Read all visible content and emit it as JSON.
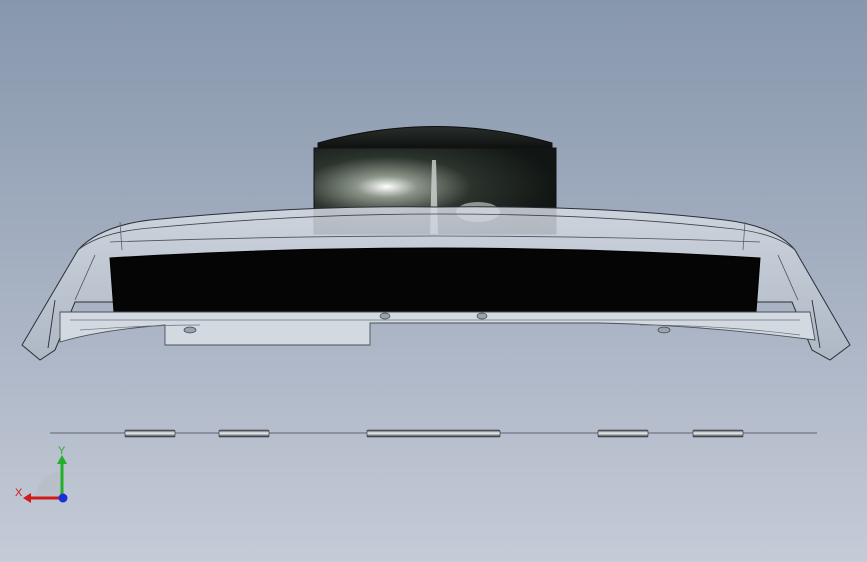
{
  "viewport": {
    "colors": {
      "bg_top": "#8797ad",
      "bg_bottom": "#c5cbd7"
    }
  },
  "triad": {
    "x_label": "X",
    "y_label": "Y",
    "colors": {
      "x": "#d11a1a",
      "y": "#22b02a",
      "z": "#1a2fd6"
    }
  },
  "model": {
    "icon": "cad-assembly-front-view"
  }
}
